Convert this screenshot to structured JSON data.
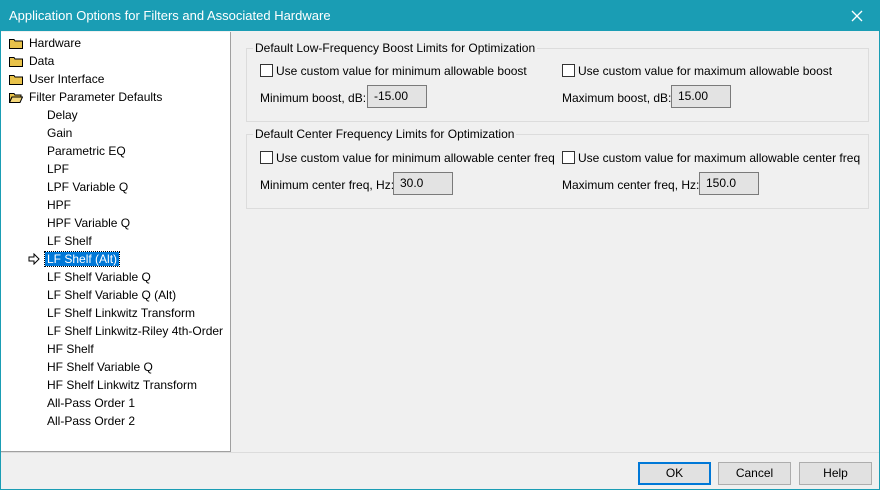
{
  "window": {
    "title": "Application Options for Filters and Associated Hardware"
  },
  "tree": {
    "folders": [
      "Hardware",
      "Data",
      "User Interface",
      "Filter Parameter Defaults"
    ],
    "children": [
      "Delay",
      "Gain",
      "Parametric EQ",
      "LPF",
      "LPF Variable Q",
      "HPF",
      "HPF Variable Q",
      "LF Shelf",
      "LF Shelf (Alt)",
      "LF Shelf Variable Q",
      "LF Shelf Variable Q (Alt)",
      "LF Shelf Linkwitz Transform",
      "LF Shelf Linkwitz-Riley 4th-Order",
      "HF Shelf",
      "HF Shelf Variable Q",
      "HF Shelf Linkwitz Transform",
      "All-Pass Order 1",
      "All-Pass Order 2"
    ],
    "selected": "LF Shelf (Alt)"
  },
  "boost": {
    "legend": "Default Low-Frequency Boost Limits for Optimization",
    "min_check": "Use custom value for minimum allowable boost",
    "max_check": "Use custom value for maximum allowable boost",
    "min_label": "Minimum boost, dB:",
    "min_value": "-15.00",
    "max_label": "Maximum boost, dB:",
    "max_value": "15.00"
  },
  "center": {
    "legend": "Default Center Frequency Limits for Optimization",
    "min_check": "Use custom value for minimum allowable center freq",
    "max_check": "Use custom value for maximum allowable center freq",
    "min_label": "Minimum center freq, Hz:",
    "min_value": "30.0",
    "max_label": "Maximum center freq, Hz:",
    "max_value": "150.0"
  },
  "buttons": {
    "ok": "OK",
    "cancel": "Cancel",
    "help": "Help"
  },
  "colors": {
    "titlebar": "#1a9db4",
    "selection": "#0078d7",
    "folder": "#e8c24a"
  }
}
